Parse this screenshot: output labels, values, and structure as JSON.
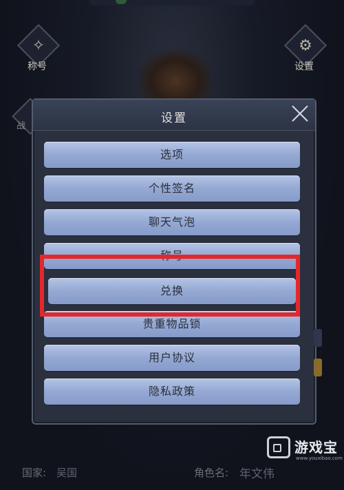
{
  "top_left_button": {
    "label": "称号",
    "icon": "emblem-icon"
  },
  "top_right_button": {
    "label": "设置",
    "icon": "gear-icon"
  },
  "left_button2": {
    "label": "战"
  },
  "dialog": {
    "title": "设置",
    "options": [
      {
        "label": "选项"
      },
      {
        "label": "个性签名"
      },
      {
        "label": "聊天气泡"
      },
      {
        "label": "称号"
      },
      {
        "label": "兑换"
      },
      {
        "label": "贵重物品锁"
      },
      {
        "label": "用户协议"
      },
      {
        "label": "隐私政策"
      }
    ],
    "highlight_color": "#e3282b"
  },
  "info": {
    "country_label": "国家:",
    "country_value": "吴国",
    "role_label": "角色名:",
    "role_value": "年文伟"
  },
  "watermark": {
    "text": "游戏宝",
    "url": "www.youxibao.com"
  }
}
